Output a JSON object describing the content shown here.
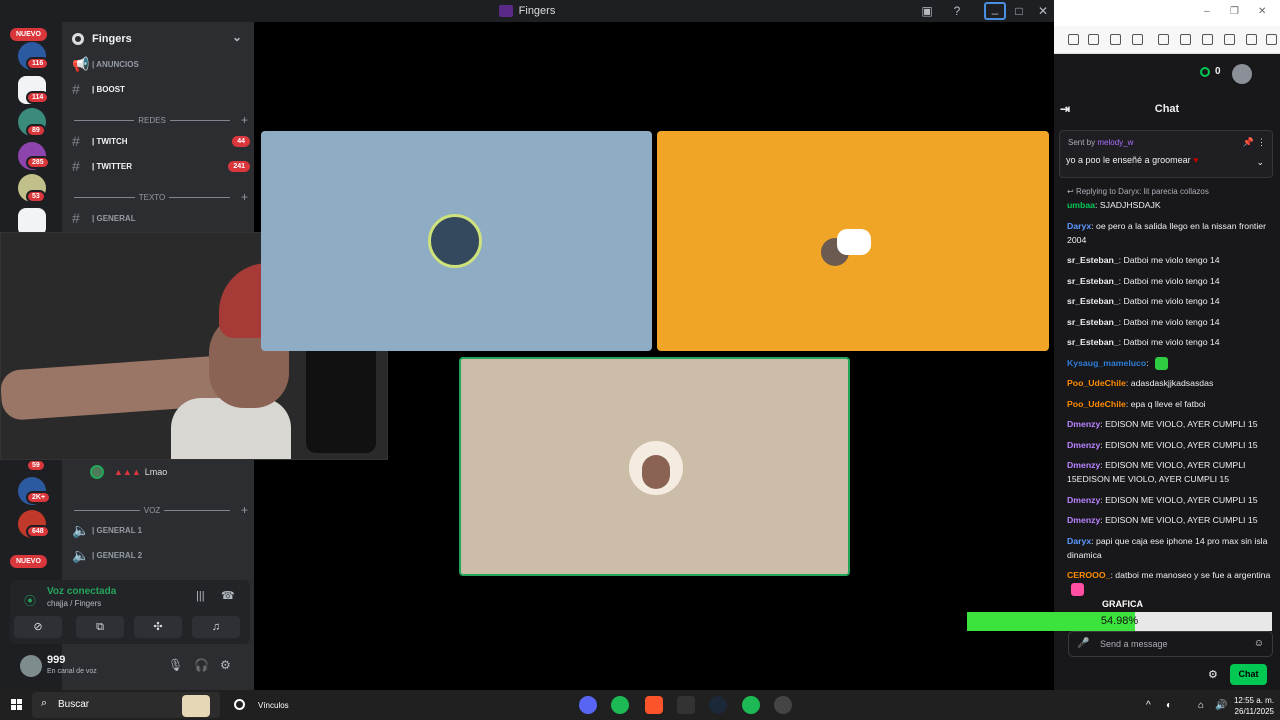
{
  "window": {
    "title": "Fingers"
  },
  "rail": {
    "top_badge": "NUEVO",
    "bottom_badge": "NUEVO",
    "counts": [
      "116",
      "114",
      "89",
      "285",
      "53",
      "59",
      "2K+",
      "648"
    ]
  },
  "server": {
    "name": "Fingers",
    "channels": [
      {
        "name": "ANUNCIOS",
        "badge": ""
      },
      {
        "name": "BOOST",
        "badge": ""
      },
      {
        "name": "TWITCH",
        "badge": "44"
      },
      {
        "name": "TWITTER",
        "badge": "241"
      },
      {
        "name": "GENERAL",
        "badge": ""
      }
    ],
    "categories": [
      "REDES",
      "TEXTO",
      "VOZ"
    ],
    "voice_user": "Lmao",
    "voice_channels": [
      "GENERAL 1",
      "GENERAL 2"
    ]
  },
  "voice_panel": {
    "status": "Voz conectada",
    "location": "chajja / Fingers"
  },
  "user_panel": {
    "name": "999",
    "status": "En canal de voz"
  },
  "browser": {
    "points": "0",
    "chat_title": "Chat",
    "pinned": {
      "sent_by_prefix": "Sent by",
      "sent_by": "melody_w",
      "message": "yo a poo le enseñé a groomear"
    },
    "reply_context": "Replying to Daryx: lit parecia collazos",
    "messages": [
      {
        "user": "umbaa",
        "text": "SJADJHSDAJK",
        "color": "#00c853"
      },
      {
        "user": "Daryx",
        "text": "oe pero a la salida llego en la nissan frontier 2004",
        "color": "#5c9bff"
      },
      {
        "user": "sr_Esteban_",
        "text": "Datboi me violo tengo 14",
        "color": "#efeff1"
      },
      {
        "user": "sr_Esteban_",
        "text": "Datboi me violo tengo 14",
        "color": "#efeff1"
      },
      {
        "user": "sr_Esteban_",
        "text": "Datboi me violo tengo 14",
        "color": "#efeff1"
      },
      {
        "user": "sr_Esteban_",
        "text": "Datboi me violo tengo 14",
        "color": "#efeff1"
      },
      {
        "user": "sr_Esteban_",
        "text": "Datboi me violo tengo 14",
        "color": "#efeff1"
      },
      {
        "user": "Kysaug_mameluco",
        "text": "",
        "color": "#2e7dd7",
        "emote": "#2ecc40"
      },
      {
        "user": "Poo_UdeChile",
        "text": "adasdaskjjkadsasdas",
        "color": "#ff8c00"
      },
      {
        "user": "Poo_UdeChile",
        "text": "epa q lleve el fatboi",
        "color": "#ff8c00"
      },
      {
        "user": "Dmenzy",
        "text": "EDISON ME VIOLO, AYER CUMPLI 15",
        "color": "#b983ff"
      },
      {
        "user": "Dmenzy",
        "text": "EDISON ME VIOLO, AYER CUMPLI 15",
        "color": "#b983ff"
      },
      {
        "user": "Dmenzy",
        "text": "EDISON ME VIOLO, AYER CUMPLI 15EDISON ME VIOLO, AYER CUMPLI 15",
        "color": "#b983ff"
      },
      {
        "user": "Dmenzy",
        "text": "EDISON ME VIOLO, AYER CUMPLI 15",
        "color": "#b983ff"
      },
      {
        "user": "Dmenzy",
        "text": "EDISON ME VIOLO, AYER CUMPLI 15",
        "color": "#b983ff"
      },
      {
        "user": "Daryx",
        "text": "papi que caja ese iphone 14 pro max sin isla dinamica",
        "color": "#5c9bff"
      },
      {
        "user": "CEROOO_",
        "text": "datboi me manoseo y se fue a argentina",
        "color": "#ff8c00",
        "emote": "#ff4fa3"
      }
    ],
    "input_placeholder": "Send a message",
    "chat_button": "Chat"
  },
  "overlay": {
    "label": "GRAFICA",
    "percent_text": "54.98%",
    "percent_value": 54.98
  },
  "taskbar": {
    "search": "Buscar",
    "links": "Vínculos",
    "time": "12:55 a. m.",
    "date": "26/11/2025"
  },
  "colors": {
    "discord_green": "#23a55a",
    "twitch_green": "#00c853",
    "gauge_green": "#3ce33c"
  }
}
